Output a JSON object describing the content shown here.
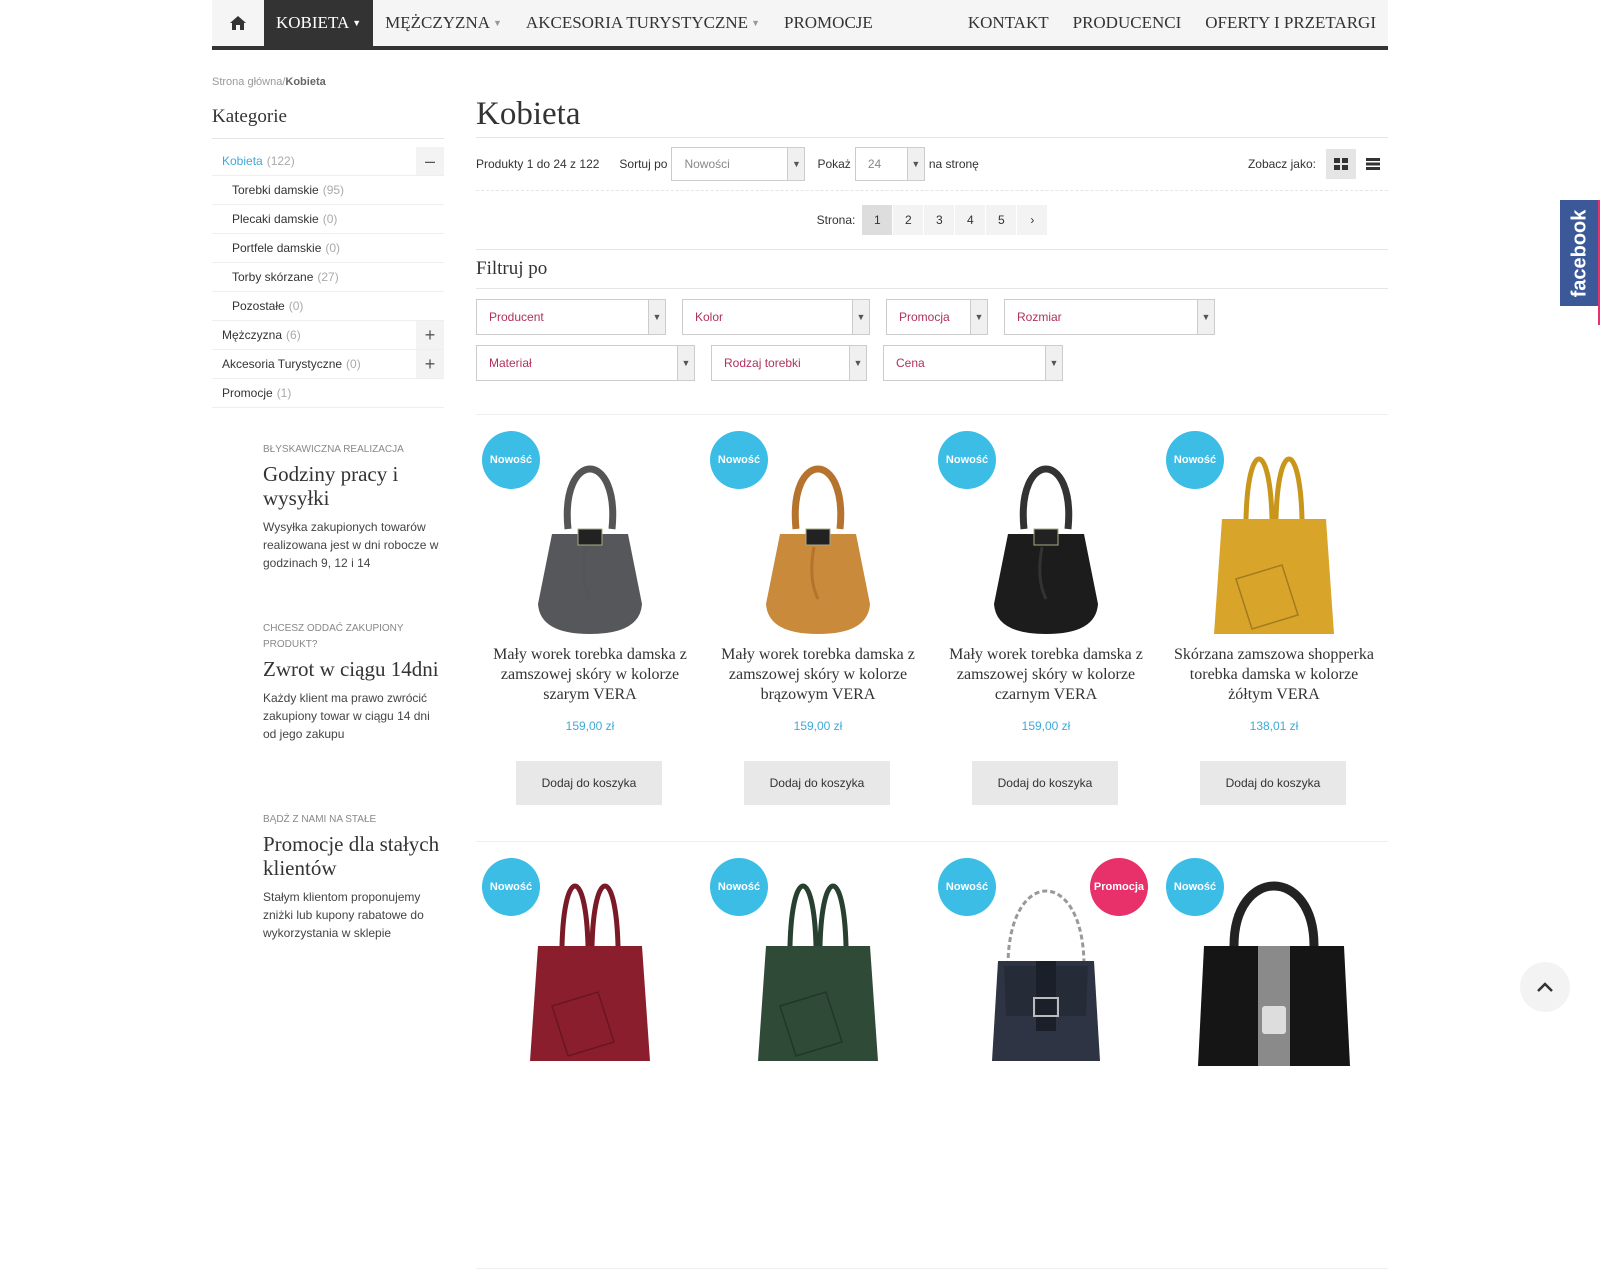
{
  "nav": {
    "left": [
      {
        "label": "KOBIETA",
        "active": true,
        "dropdown": true
      },
      {
        "label": "MĘŻCZYZNA",
        "active": false,
        "dropdown": true
      },
      {
        "label": "AKCESORIA TURYSTYCZNE",
        "active": false,
        "dropdown": true
      },
      {
        "label": "PROMOCJE",
        "active": false,
        "dropdown": false
      }
    ],
    "right": [
      {
        "label": "KONTAKT"
      },
      {
        "label": "PRODUCENCI"
      },
      {
        "label": "OFERTY I PRZETARGI"
      }
    ]
  },
  "breadcrumb": {
    "home": "Strona główna",
    "sep": "/",
    "current": "Kobieta"
  },
  "sidebar": {
    "title": "Kategorie",
    "categories": [
      {
        "name": "Kobieta",
        "count": "(122)",
        "toggle": "–"
      },
      {
        "name": "Torebki damskie",
        "count": "(95)"
      },
      {
        "name": "Plecaki damskie",
        "count": "(0)"
      },
      {
        "name": "Portfele damskie",
        "count": "(0)"
      },
      {
        "name": "Torby skórzane",
        "count": "(27)"
      },
      {
        "name": "Pozostałe",
        "count": "(0)"
      },
      {
        "name": "Mężczyzna",
        "count": "(6)",
        "toggle": "+"
      },
      {
        "name": "Akcesoria Turystyczne",
        "count": "(0)",
        "toggle": "+"
      },
      {
        "name": "Promocje",
        "count": "(1)"
      }
    ],
    "info": [
      {
        "small": "BŁYSKAWICZNA REALIZACJA",
        "big": "Godziny pracy i wysyłki",
        "text": "Wysyłka zakupionych towarów realizowana jest w dni robocze w godzinach 9, 12 i 14"
      },
      {
        "small": "CHCESZ ODDAĆ ZAKUPIONY PRODUKT?",
        "big": "Zwrot w ciągu 14dni",
        "text": "Każdy klient ma prawo zwrócić zakupiony towar w ciągu 14 dni od jego zakupu"
      },
      {
        "small": "BĄDŹ Z NAMI NA STAŁE",
        "big": "Promocje dla stałych klientów",
        "text": "Stałym klientom proponujemy zniżki lub kupony rabatowe do wykorzystania w sklepie"
      }
    ]
  },
  "main": {
    "title": "Kobieta",
    "products_range": "Produkty 1 do 24 z 122",
    "sort_label": "Sortuj po",
    "sort_value": "Nowości",
    "show_label": "Pokaż",
    "show_value": "24",
    "per_page": "na stronę",
    "view_as": "Zobacz jako:",
    "pager_label": "Strona:",
    "pages": [
      "1",
      "2",
      "3",
      "4",
      "5",
      "›"
    ],
    "filter_title": "Filtruj po",
    "filters_row1": [
      "Producent",
      "Kolor",
      "Promocja",
      "Rozmiar"
    ],
    "filters_row2": [
      "Materiał",
      "Rodzaj torebki",
      "Cena"
    ]
  },
  "products": [
    {
      "name": "Mały worek torebka damska z zamszowej skóry w kolorze szarym VERA",
      "price": "159,00 zł",
      "badge": "Nowość",
      "color": "#55575a",
      "handle": "#555",
      "shape": "bucket"
    },
    {
      "name": "Mały worek torebka damska z zamszowej skóry w kolorze brązowym VERA",
      "price": "159,00 zł",
      "badge": "Nowość",
      "color": "#c98a3c",
      "handle": "#b5732d",
      "shape": "bucket"
    },
    {
      "name": "Mały worek torebka damska z zamszowej skóry w kolorze czarnym VERA",
      "price": "159,00 zł",
      "badge": "Nowość",
      "color": "#1c1c1c",
      "handle": "#333",
      "shape": "bucket"
    },
    {
      "name": "Skórzana zamszowa shopperka torebka damska w kolorze żółtym VERA",
      "price": "138,01 zł",
      "badge": "Nowość",
      "color": "#d8a52a",
      "handle": "#c9961c",
      "shape": "tote"
    },
    {
      "name": "",
      "price": "",
      "badge": "Nowość",
      "color": "#8b1e2c",
      "handle": "#7a1a26",
      "shape": "tote"
    },
    {
      "name": "",
      "price": "",
      "badge": "Nowość",
      "color": "#2f4a36",
      "handle": "#274030",
      "shape": "tote"
    },
    {
      "name": "",
      "price": "",
      "badge": "Nowość",
      "promo": "Promocja",
      "color": "#2e3443",
      "handle": "#999",
      "shape": "flap"
    },
    {
      "name": "",
      "price": "",
      "badge": "Nowość",
      "color": "#151515",
      "handle": "#222",
      "shape": "box"
    }
  ],
  "cart_label": "Dodaj do koszyka",
  "facebook": "facebook",
  "colors": {
    "accent": "#3fa9d8",
    "new_badge": "#3bbde6",
    "promo_badge": "#e8306a",
    "filter_text": "#b0305f",
    "facebook": "#3b5998"
  }
}
